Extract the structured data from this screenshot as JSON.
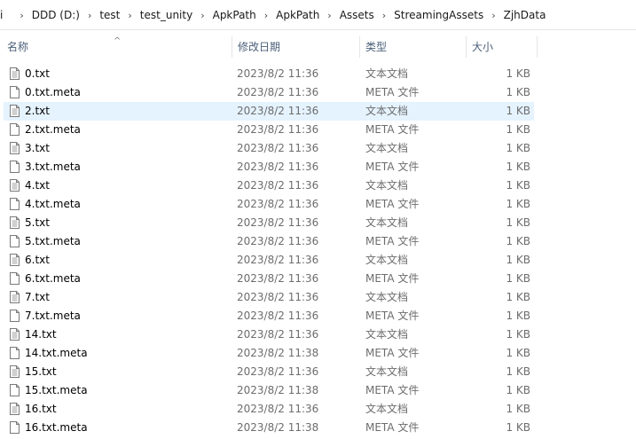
{
  "breadcrumb": {
    "lead": "i",
    "items": [
      "DDD (D:)",
      "test",
      "test_unity",
      "ApkPath",
      "ApkPath",
      "Assets",
      "StreamingAssets",
      "ZjhData"
    ],
    "separator": "›"
  },
  "columns": {
    "name": "名称",
    "date": "修改日期",
    "type": "类型",
    "size": "大小",
    "sort_indicator": "^"
  },
  "files": [
    {
      "name": "0.txt",
      "date": "2023/8/2 11:36",
      "type": "文本文档",
      "size": "1 KB",
      "icon": "text-file-icon"
    },
    {
      "name": "0.txt.meta",
      "date": "2023/8/2 11:36",
      "type": "META 文件",
      "size": "1 KB",
      "icon": "blank-file-icon"
    },
    {
      "name": "2.txt",
      "date": "2023/8/2 11:36",
      "type": "文本文档",
      "size": "1 KB",
      "icon": "text-file-icon",
      "selected": true
    },
    {
      "name": "2.txt.meta",
      "date": "2023/8/2 11:36",
      "type": "META 文件",
      "size": "1 KB",
      "icon": "blank-file-icon"
    },
    {
      "name": "3.txt",
      "date": "2023/8/2 11:36",
      "type": "文本文档",
      "size": "1 KB",
      "icon": "text-file-icon"
    },
    {
      "name": "3.txt.meta",
      "date": "2023/8/2 11:36",
      "type": "META 文件",
      "size": "1 KB",
      "icon": "blank-file-icon"
    },
    {
      "name": "4.txt",
      "date": "2023/8/2 11:36",
      "type": "文本文档",
      "size": "1 KB",
      "icon": "text-file-icon"
    },
    {
      "name": "4.txt.meta",
      "date": "2023/8/2 11:36",
      "type": "META 文件",
      "size": "1 KB",
      "icon": "blank-file-icon"
    },
    {
      "name": "5.txt",
      "date": "2023/8/2 11:36",
      "type": "文本文档",
      "size": "1 KB",
      "icon": "text-file-icon"
    },
    {
      "name": "5.txt.meta",
      "date": "2023/8/2 11:36",
      "type": "META 文件",
      "size": "1 KB",
      "icon": "blank-file-icon"
    },
    {
      "name": "6.txt",
      "date": "2023/8/2 11:36",
      "type": "文本文档",
      "size": "1 KB",
      "icon": "text-file-icon"
    },
    {
      "name": "6.txt.meta",
      "date": "2023/8/2 11:36",
      "type": "META 文件",
      "size": "1 KB",
      "icon": "blank-file-icon"
    },
    {
      "name": "7.txt",
      "date": "2023/8/2 11:36",
      "type": "文本文档",
      "size": "1 KB",
      "icon": "text-file-icon"
    },
    {
      "name": "7.txt.meta",
      "date": "2023/8/2 11:36",
      "type": "META 文件",
      "size": "1 KB",
      "icon": "blank-file-icon"
    },
    {
      "name": "14.txt",
      "date": "2023/8/2 11:36",
      "type": "文本文档",
      "size": "1 KB",
      "icon": "text-file-icon"
    },
    {
      "name": "14.txt.meta",
      "date": "2023/8/2 11:38",
      "type": "META 文件",
      "size": "1 KB",
      "icon": "blank-file-icon"
    },
    {
      "name": "15.txt",
      "date": "2023/8/2 11:36",
      "type": "文本文档",
      "size": "1 KB",
      "icon": "text-file-icon"
    },
    {
      "name": "15.txt.meta",
      "date": "2023/8/2 11:38",
      "type": "META 文件",
      "size": "1 KB",
      "icon": "blank-file-icon"
    },
    {
      "name": "16.txt",
      "date": "2023/8/2 11:36",
      "type": "文本文档",
      "size": "1 KB",
      "icon": "text-file-icon"
    },
    {
      "name": "16.txt.meta",
      "date": "2023/8/2 11:38",
      "type": "META 文件",
      "size": "1 KB",
      "icon": "blank-file-icon"
    }
  ],
  "colors": {
    "selected_row": "#e5f3ff",
    "header_text": "#4c607a",
    "secondary_text": "#6d6d6d"
  }
}
